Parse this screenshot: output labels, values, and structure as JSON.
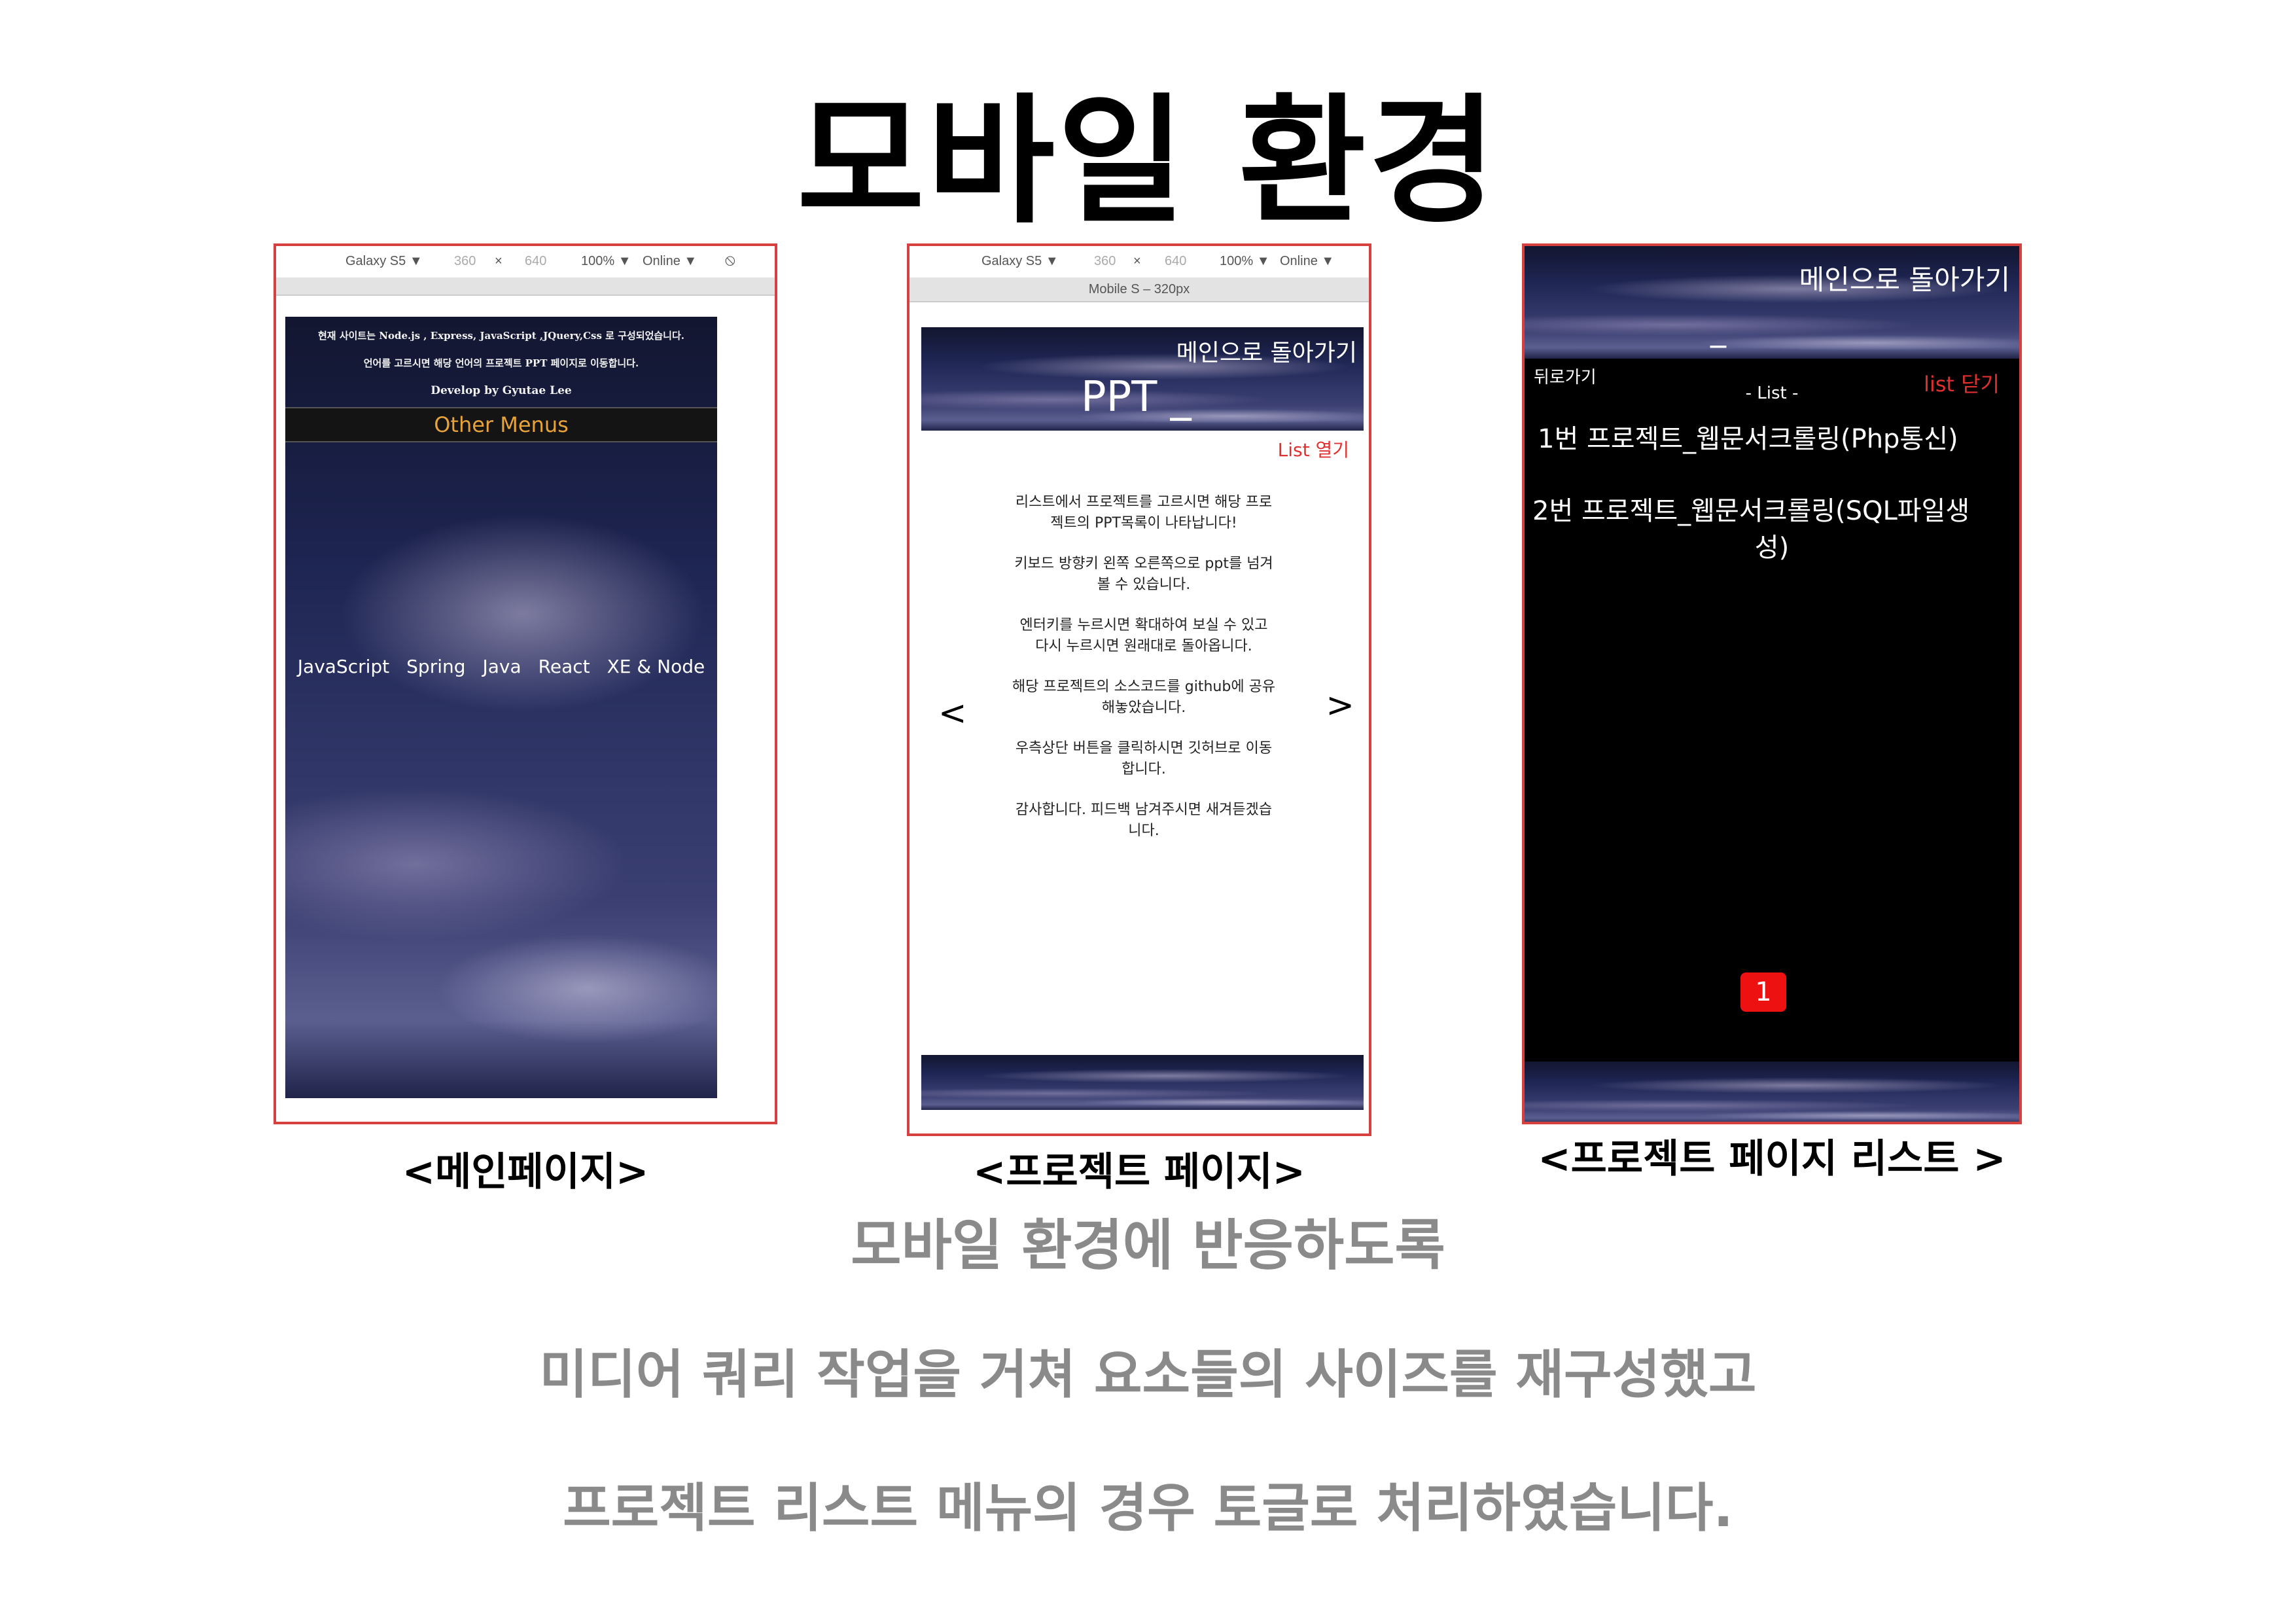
{
  "page": {
    "title": "모바일 환경",
    "description": {
      "line1": "모바일 환경에 반응하도록",
      "line2": "미디어 쿼리 작업을 거쳐 요소들의 사이즈를 재구성했고",
      "line3": "프로젝트 리스트 메뉴의 경우 토글로 처리하였습니다."
    }
  },
  "devtools": {
    "device": "Galaxy S5 ▼",
    "width": "360",
    "times": "×",
    "height": "640",
    "zoom": "100% ▼",
    "network": "Online ▼",
    "media_label": "Mobile S – 320px"
  },
  "main_page": {
    "caption": "<메인페이지>",
    "intro_line1": "현재 사이트는 Node.js , Express, JavaScript ,JQuery,Css 로 구성되었습니다.",
    "intro_line2": "언어를 고르시면 해당 언어의 프로젝트 PPT 페이지로 이동합니다.",
    "intro_line3": "Develop by Gyutae Lee",
    "other_menus": "Other Menus",
    "nav": [
      "JavaScript",
      "Spring",
      "Java",
      "React",
      "XE & Node"
    ]
  },
  "project_page": {
    "caption": "<프로젝트 페이지>",
    "back_to_main": "메인으로 돌아가기",
    "heading": "PPT _",
    "list_open": "List 열기",
    "prev": "<",
    "next": ">",
    "paragraphs": [
      [
        "리스트에서 프로젝트를 고르시면 해당 프로",
        "젝트의 PPT목록이 나타납니다!"
      ],
      [
        "키보드 방향키 왼쪽 오른쪽으로 ppt를 넘겨",
        "볼 수 있습니다."
      ],
      [
        "엔터키를 누르시면 확대하여 보실 수 있고",
        "다시 누르시면 원래대로 돌아옵니다."
      ],
      [
        "해당 프로젝트의 소스코드를 github에 공유",
        "해놓았습니다."
      ],
      [
        "우측상단 버튼을 클릭하시면 깃허브로 이동",
        "합니다."
      ],
      [
        "감사합니다. 피드백 남겨주시면 새겨듣겠습",
        "니다."
      ]
    ]
  },
  "list_page": {
    "caption": "<프로젝트 페이지 리스트 >",
    "back_to_main": "메인으로 돌아가기",
    "cursor": "_",
    "back": "뒤로가기",
    "list_title": "- List -",
    "list_close": "list 닫기",
    "items": [
      "1번 프로젝트_웹문서크롤링(Php통신)",
      "2번 프로젝트_웹문서크롤링(SQL파일생",
      "성)"
    ],
    "page_number": "1"
  },
  "colors": {
    "accent_border": "#d6403e",
    "other_menus": "#e8a23a",
    "list_red": "#e03030",
    "page_badge": "#ee1111"
  }
}
